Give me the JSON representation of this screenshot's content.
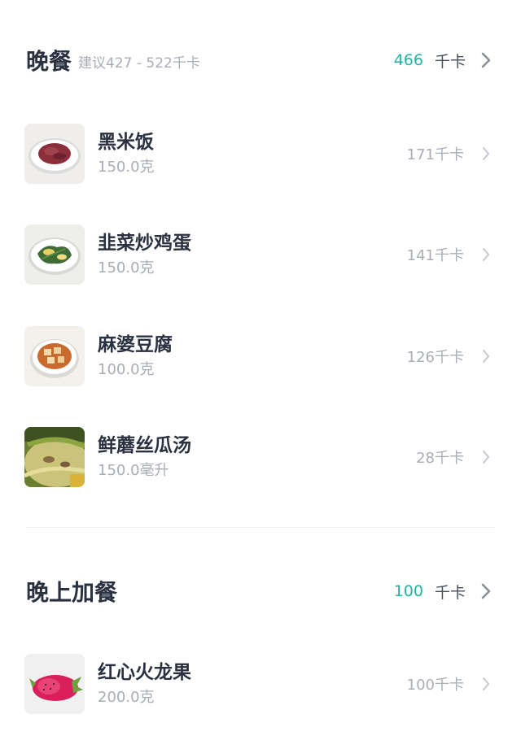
{
  "dinner": {
    "title": "晚餐",
    "suggest": "建议427 - 522千卡",
    "kcal": "466",
    "unit": "千卡",
    "items": [
      {
        "name": "黑米饭",
        "amount": "150.0克",
        "kcal": "171千卡",
        "icon": "black-rice-photo"
      },
      {
        "name": "韭菜炒鸡蛋",
        "amount": "150.0克",
        "kcal": "141千卡",
        "icon": "chive-egg-photo"
      },
      {
        "name": "麻婆豆腐",
        "amount": "100.0克",
        "kcal": "126千卡",
        "icon": "mapo-tofu-photo"
      },
      {
        "name": "鲜蘑丝瓜汤",
        "amount": "150.0毫升",
        "kcal": "28千卡",
        "icon": "mushroom-loofah-soup-photo"
      }
    ]
  },
  "night_snack": {
    "title": "晚上加餐",
    "kcal": "100",
    "unit": "千卡",
    "items": [
      {
        "name": "红心火龙果",
        "amount": "200.0克",
        "kcal": "100千卡",
        "icon": "red-dragon-fruit-photo"
      }
    ]
  },
  "colors": {
    "accent": "#1fb6a6",
    "title": "#2a3140",
    "muted": "#a9adb5",
    "chevron": "#c5c9cf"
  }
}
